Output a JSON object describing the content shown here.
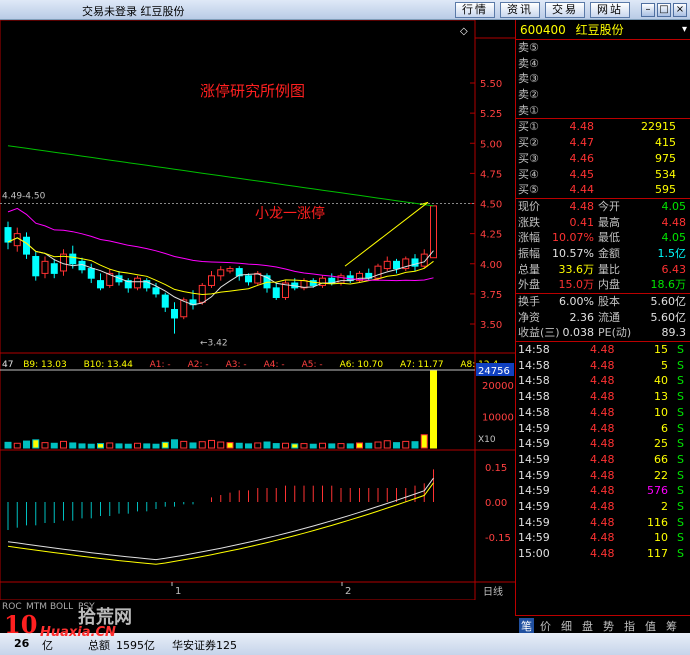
{
  "titlebar": {
    "title": "交易未登录  红豆股份",
    "buttons": [
      "行情",
      "资讯",
      "交易",
      "网站"
    ]
  },
  "chart": {
    "annotation_main": "涨停研究所例图",
    "annotation_sub": "小龙一涨停",
    "price_ticks": [
      "5.50",
      "5.25",
      "5.00",
      "4.75",
      "4.50",
      "4.25",
      "4.00",
      "3.75",
      "3.50"
    ],
    "range_label": "4.49-4.50",
    "low_label": "3.42",
    "ma_header": [
      "47",
      "B9: 13.03",
      "B10: 13.44",
      "A1: -",
      "A2: -",
      "A3: -",
      "A4: -",
      "A5: -",
      "A6: 10.70",
      "A7: 11.77",
      "A8: 12.4"
    ],
    "vol_badge": "24756",
    "vol_ticks": [
      "20000",
      "10000"
    ],
    "vol_unit": "X10",
    "macd_ticks": [
      "0.15",
      "0.00",
      "-0.15"
    ],
    "x_labels": [
      "1",
      "2"
    ],
    "period": "日线",
    "bottom_tabs": [
      "ROC",
      "MTM",
      "BOLL",
      "PSY"
    ]
  },
  "quote": {
    "code": "600400",
    "name": "红豆股份",
    "sells": [
      {
        "label": "卖⑤",
        "price": "",
        "vol": ""
      },
      {
        "label": "卖④",
        "price": "",
        "vol": ""
      },
      {
        "label": "卖③",
        "price": "",
        "vol": ""
      },
      {
        "label": "卖②",
        "price": "",
        "vol": ""
      },
      {
        "label": "卖①",
        "price": "",
        "vol": ""
      }
    ],
    "buys": [
      {
        "label": "买①",
        "price": "4.48",
        "vol": "22915"
      },
      {
        "label": "买②",
        "price": "4.47",
        "vol": "415"
      },
      {
        "label": "买③",
        "price": "4.46",
        "vol": "975"
      },
      {
        "label": "买④",
        "price": "4.45",
        "vol": "534"
      },
      {
        "label": "买⑤",
        "price": "4.44",
        "vol": "595"
      }
    ],
    "stats1": [
      {
        "a": "现价",
        "b": "4.48",
        "bc": "red",
        "c": "今开",
        "d": "4.05",
        "dc": "green"
      },
      {
        "a": "涨跌",
        "b": "0.41",
        "bc": "red",
        "c": "最高",
        "d": "4.48",
        "dc": "red"
      },
      {
        "a": "涨幅",
        "b": "10.07%",
        "bc": "red",
        "c": "最低",
        "d": "4.05",
        "dc": "green"
      },
      {
        "a": "振幅",
        "b": "10.57%",
        "bc": "white",
        "c": "金额",
        "d": "1.5亿",
        "dc": "cyan"
      },
      {
        "a": "总量",
        "b": "33.6万",
        "bc": "yellow",
        "c": "量比",
        "d": "6.43",
        "dc": "red"
      },
      {
        "a": "外盘",
        "b": "15.0万",
        "bc": "red",
        "c": "内盘",
        "d": "18.6万",
        "dc": "green"
      }
    ],
    "stats2": [
      {
        "a": "换手",
        "b": "6.00%",
        "bc": "white",
        "c": "股本",
        "d": "5.60亿",
        "dc": "white"
      },
      {
        "a": "净资",
        "b": "2.36",
        "bc": "white",
        "c": "流通",
        "d": "5.60亿",
        "dc": "white"
      },
      {
        "a": "收益(三)",
        "b": "0.038",
        "bc": "white",
        "c": "PE(动)",
        "d": "89.3",
        "dc": "white"
      }
    ],
    "ticks": [
      {
        "t": "14:58",
        "p": "4.48",
        "v": "15",
        "vc": "yellow",
        "s": "S"
      },
      {
        "t": "14:58",
        "p": "4.48",
        "v": "5",
        "vc": "yellow",
        "s": "S"
      },
      {
        "t": "14:58",
        "p": "4.48",
        "v": "40",
        "vc": "yellow",
        "s": "S"
      },
      {
        "t": "14:58",
        "p": "4.48",
        "v": "13",
        "vc": "yellow",
        "s": "S"
      },
      {
        "t": "14:58",
        "p": "4.48",
        "v": "10",
        "vc": "yellow",
        "s": "S"
      },
      {
        "t": "14:59",
        "p": "4.48",
        "v": "6",
        "vc": "yellow",
        "s": "S"
      },
      {
        "t": "14:59",
        "p": "4.48",
        "v": "25",
        "vc": "yellow",
        "s": "S"
      },
      {
        "t": "14:59",
        "p": "4.48",
        "v": "66",
        "vc": "yellow",
        "s": "S"
      },
      {
        "t": "14:59",
        "p": "4.48",
        "v": "22",
        "vc": "yellow",
        "s": "S"
      },
      {
        "t": "14:59",
        "p": "4.48",
        "v": "576",
        "vc": "mag",
        "s": "S"
      },
      {
        "t": "14:59",
        "p": "4.48",
        "v": "2",
        "vc": "yellow",
        "s": "S"
      },
      {
        "t": "14:59",
        "p": "4.48",
        "v": "116",
        "vc": "yellow",
        "s": "S"
      },
      {
        "t": "14:59",
        "p": "4.48",
        "v": "10",
        "vc": "yellow",
        "s": "S"
      },
      {
        "t": "15:00",
        "p": "4.48",
        "v": "117",
        "vc": "yellow",
        "s": "S"
      }
    ],
    "tabs": [
      "笔",
      "价",
      "细",
      "盘",
      "势",
      "指",
      "值",
      "筹"
    ]
  },
  "status": {
    "broker": "华安证券125",
    "fragment1": "26",
    "fragment2": "亿",
    "fragment3": "总额",
    "fragment4": "1595亿"
  },
  "watermark": {
    "logo": "10",
    "site": "Huaxia.CN",
    "brand": "拾荒网"
  },
  "colors": {
    "up": "#ff3232",
    "down": "#00ffff",
    "ma_white": "#e0e0e0",
    "ma_yellow": "#ffff00",
    "ma_magenta": "#ff00ff",
    "ma_green": "#00c000",
    "border": "#b00000"
  }
}
